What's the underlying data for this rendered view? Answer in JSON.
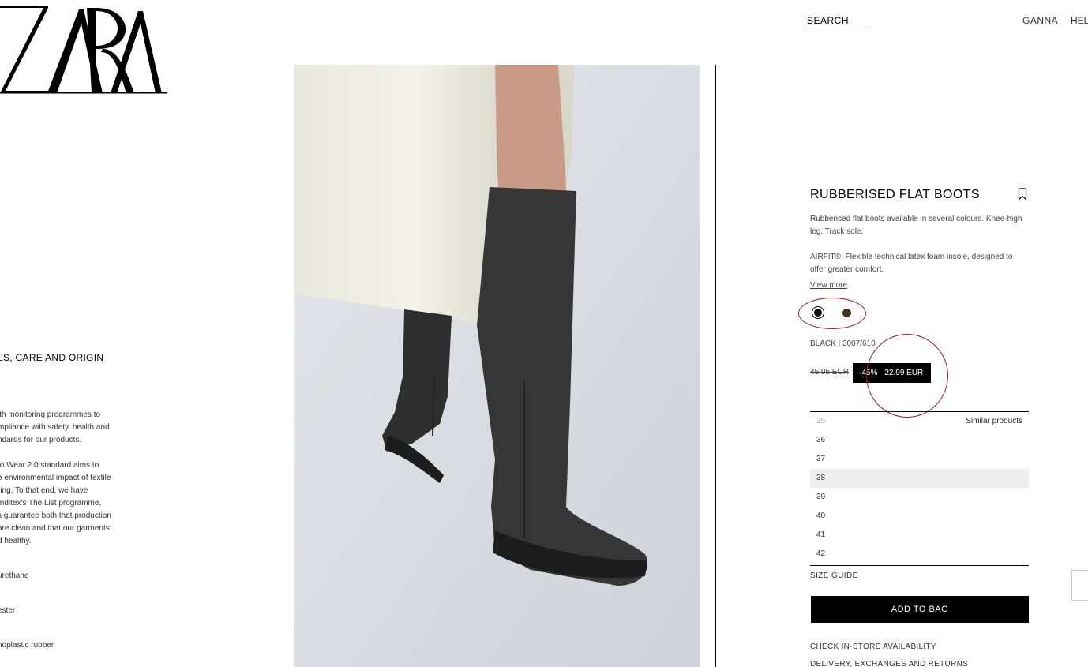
{
  "brand": {
    "logo_text": "ZARA"
  },
  "header": {
    "search_label": "SEARCH",
    "user_label": "GANNA",
    "help_label": "HEL"
  },
  "left_info": {
    "heading": "LS, CARE AND ORIGIN",
    "paragraph1": [
      "ith monitoring programmes to",
      "mpliance with safety, health and",
      "ndards for our products."
    ],
    "paragraph2": [
      "to Wear 2.0 standard aims to",
      "e environmental impact of textile",
      "ring. To that end, we have",
      "Inditex's The List programme,",
      "s guarantee both that production",
      "are clean and that our garments",
      "d healthy."
    ],
    "material1": "urethane",
    "material2": "ester",
    "material3": "noplastic rubber"
  },
  "product": {
    "title": "RUBBERISED FLAT BOOTS",
    "description1": "Rubberised flat boots available in several colours. Knee-high leg. Track sole.",
    "description2": "AIRFIT®. Flexible technical latex foam insole, designed to offer greater comfort.",
    "view_more": "View more",
    "colors": [
      {
        "name": "black",
        "hex": "#111111",
        "selected": true
      },
      {
        "name": "khaki",
        "hex": "#3a3420",
        "selected": false
      }
    ],
    "color_code": "BLACK | 3007/610",
    "old_price": "45.95 EUR",
    "discount": "-45%",
    "new_price": "22.99 EUR",
    "sizes": [
      {
        "label": "35",
        "disabled": true
      },
      {
        "label": "36"
      },
      {
        "label": "37"
      },
      {
        "label": "38",
        "highlighted": true
      },
      {
        "label": "39"
      },
      {
        "label": "40"
      },
      {
        "label": "41"
      },
      {
        "label": "42"
      }
    ],
    "similar_products": "Similar products",
    "size_guide": "SIZE GUIDE",
    "add_to_bag": "ADD TO BAG",
    "check_store": "CHECK IN-STORE AVAILABILITY",
    "delivery": "DELIVERY, EXCHANGES AND RETURNS"
  },
  "colors": {
    "annotation_red": "#a02020",
    "button_black": "#000000",
    "highlight_gray": "#efefef"
  }
}
